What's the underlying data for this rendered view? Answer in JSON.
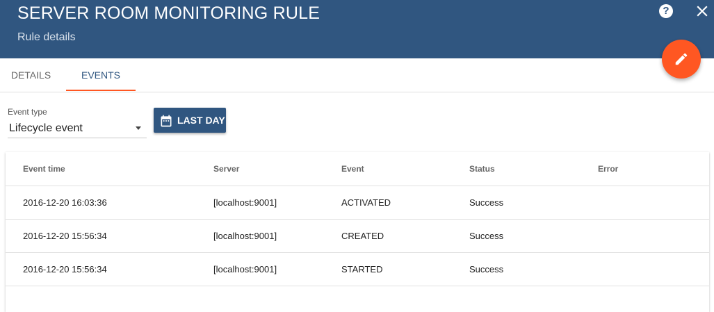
{
  "header": {
    "title": "SERVER ROOM MONITORING RULE",
    "subtitle": "Rule details",
    "help_icon": "help-circle-icon",
    "close_icon": "close-icon",
    "edit_icon": "pencil-icon"
  },
  "tabs": [
    {
      "label": "DETAILS",
      "active": false
    },
    {
      "label": "EVENTS",
      "active": true
    }
  ],
  "filters": {
    "event_type_label": "Event type",
    "event_type_value": "Lifecycle event",
    "time_button_label": "LAST DAY",
    "time_button_icon": "calendar-icon"
  },
  "table": {
    "columns": [
      "Event time",
      "Server",
      "Event",
      "Status",
      "Error"
    ],
    "rows": [
      [
        "2016-12-20 16:03:36",
        "[localhost:9001]",
        "ACTIVATED",
        "Success",
        ""
      ],
      [
        "2016-12-20 15:56:34",
        "[localhost:9001]",
        "CREATED",
        "Success",
        ""
      ],
      [
        "2016-12-20 15:56:34",
        "[localhost:9001]",
        "STARTED",
        "Success",
        ""
      ]
    ]
  },
  "colors": {
    "header": "#305680",
    "accent": "#ff5722",
    "tab_active": "#305680"
  }
}
